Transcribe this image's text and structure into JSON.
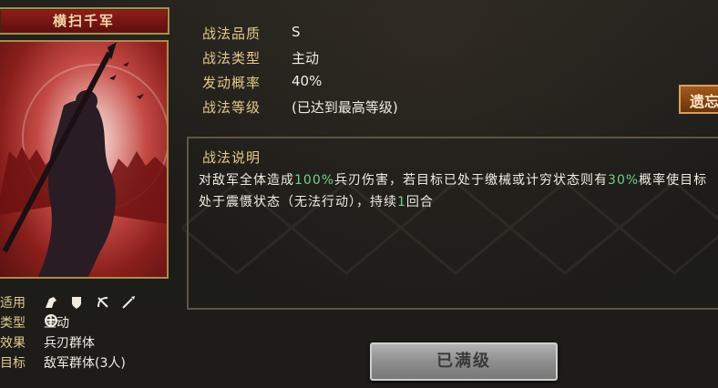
{
  "skill": {
    "name": "横扫千军"
  },
  "left_info": {
    "troops_label": "适用",
    "troop_icons": [
      "cavalry-icon",
      "shield-icon",
      "bow-icon",
      "spear-icon",
      "wheel-icon"
    ],
    "type_label": "类型",
    "type_value": "主动",
    "effect_label": "效果",
    "effect_value": "兵刃群体",
    "target_label": "目标",
    "target_value": "敌军群体(3人)"
  },
  "stats": {
    "quality_label": "战法品质",
    "quality_value": "S",
    "category_label": "战法类型",
    "category_value": "主动",
    "rate_label": "发动概率",
    "rate_value": "40%",
    "level_label": "战法等级",
    "level_value": "(已达到最高等级)"
  },
  "legacy_button": {
    "label": "遗忘"
  },
  "description": {
    "title": "战法说明",
    "part1": "对敌军全体造成",
    "dmg": "100%",
    "part2": "兵刃伤害，若目标已处于缴械或计穷状态则有",
    "chance": "30%",
    "part3": "概率使目标处于震慑状态（无法行动），持续",
    "turns": "1",
    "part4": "回合"
  },
  "action": {
    "maxed_label": "已满级"
  },
  "colors": {
    "label_gold": "#e4c98c",
    "highlight_green": "#6fd28b",
    "title_red": "#8f1f1a",
    "legacy_orange": "#a35a1e"
  }
}
